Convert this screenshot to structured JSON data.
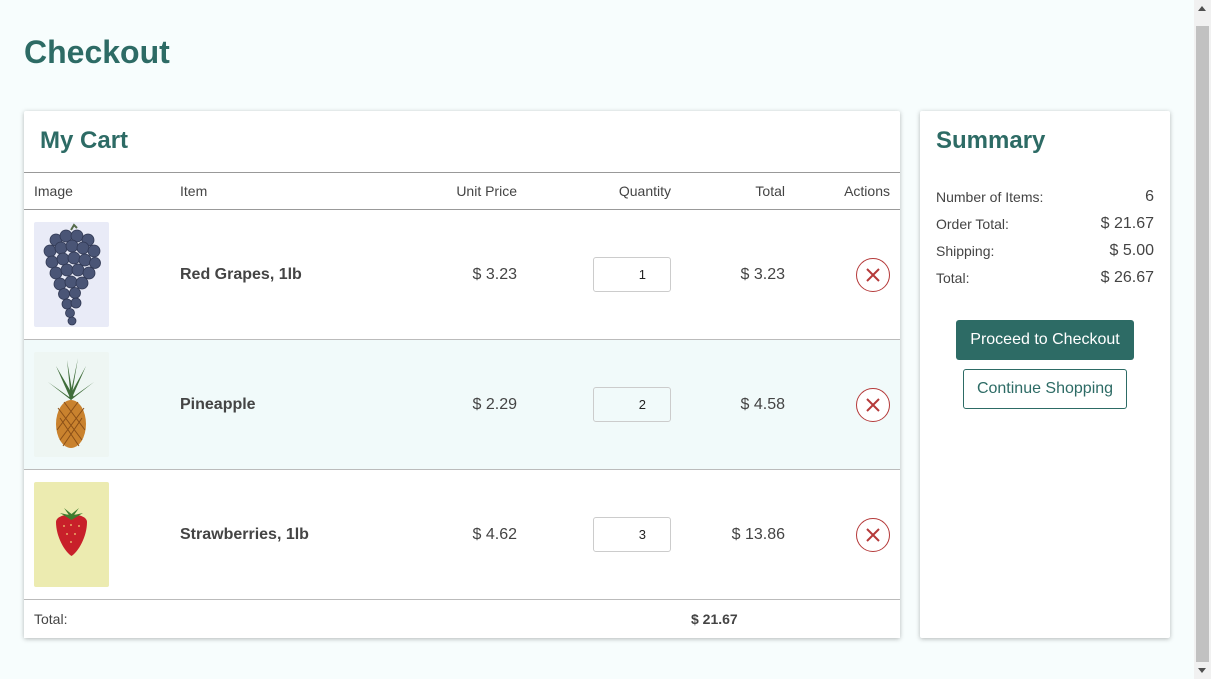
{
  "page": {
    "title": "Checkout"
  },
  "cart": {
    "title": "My Cart",
    "columns": {
      "image": "Image",
      "item": "Item",
      "unit_price": "Unit Price",
      "quantity": "Quantity",
      "total": "Total",
      "actions": "Actions"
    },
    "items": [
      {
        "name": "Red Grapes, 1lb",
        "unit_price": "$ 3.23",
        "quantity": "1",
        "total": "$ 3.23",
        "image_icon": "grapes-image"
      },
      {
        "name": "Pineapple",
        "unit_price": "$ 2.29",
        "quantity": "2",
        "total": "$ 4.58",
        "image_icon": "pineapple-image"
      },
      {
        "name": "Strawberries, 1lb",
        "unit_price": "$ 4.62",
        "quantity": "3",
        "total": "$ 13.86",
        "image_icon": "strawberry-image"
      }
    ],
    "footer": {
      "label": "Total:",
      "value": "$ 21.67"
    }
  },
  "summary": {
    "title": "Summary",
    "rows": [
      {
        "label": "Number of Items:",
        "value": "6"
      },
      {
        "label": "Order Total:",
        "value": "$ 21.67"
      },
      {
        "label": "Shipping:",
        "value": "$ 5.00"
      },
      {
        "label": "Total:",
        "value": "$ 26.67"
      }
    ],
    "proceed_label": "Proceed to Checkout",
    "continue_label": "Continue Shopping"
  },
  "colors": {
    "brand": "#2d6b65",
    "remove": "#b53a3a",
    "row_highlight": "#f1fafa",
    "background": "#f7fdfd"
  }
}
